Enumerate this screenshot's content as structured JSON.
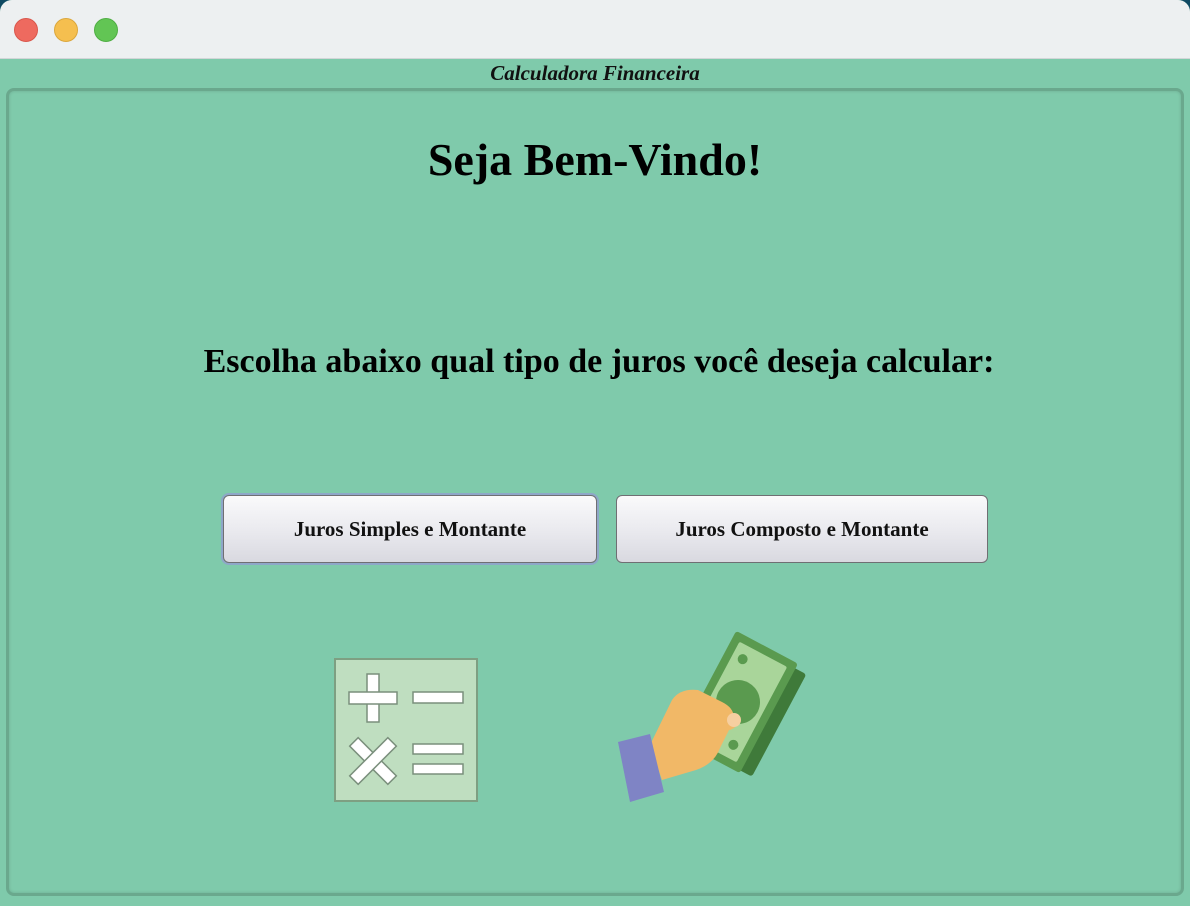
{
  "window": {
    "title": "Calculadora Financeira",
    "controls": [
      "close",
      "minimize",
      "maximize"
    ]
  },
  "main": {
    "welcome": "Seja Bem-Vindo!",
    "prompt": "Escolha abaixo qual tipo de juros você deseja calcular:",
    "buttons": {
      "simples": "Juros Simples e Montante",
      "composto": "Juros Composto e Montante"
    },
    "icons": [
      "calculator-operations-icon",
      "hand-money-icon"
    ]
  },
  "colors": {
    "background": "#7fcaab",
    "titlebar": "#edf0f1",
    "button_focus_ring": "#8ea7c8"
  }
}
